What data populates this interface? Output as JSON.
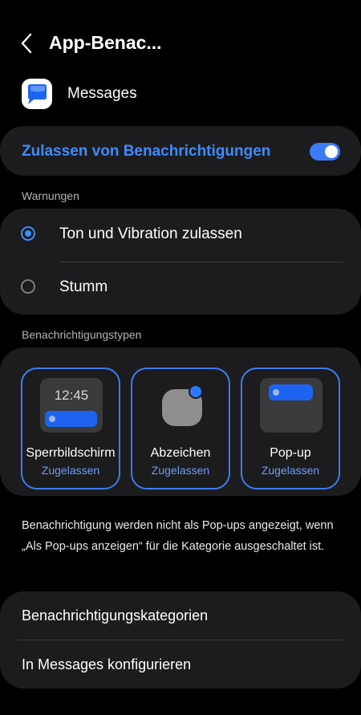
{
  "header": {
    "title": "App-Benac..."
  },
  "app": {
    "name": "Messages"
  },
  "toggle": {
    "label": "Zulassen von Benachrichtigungen",
    "on": true,
    "accent": "#3e8bff"
  },
  "warnings": {
    "section_label": "Warnungen",
    "options": [
      {
        "label": "Ton und Vibration zulassen",
        "selected": true
      },
      {
        "label": "Stumm",
        "selected": false
      }
    ]
  },
  "types": {
    "section_label": "Benachrichtigungstypen",
    "items": [
      {
        "name": "Sperrbildschirm",
        "status": "Zugelassen",
        "preview_time": "12:45"
      },
      {
        "name": "Abzeichen",
        "status": "Zugelassen"
      },
      {
        "name": "Pop-up",
        "status": "Zugelassen"
      }
    ]
  },
  "info_text": "Benachrichtigung werden nicht als Pop-ups angezeigt, wenn „Als Pop-ups anzeigen“ für die Kategorie ausgeschaltet ist.",
  "links": [
    {
      "label": "Benachrichtigungskategorien"
    },
    {
      "label": "In Messages konfigurieren"
    }
  ]
}
